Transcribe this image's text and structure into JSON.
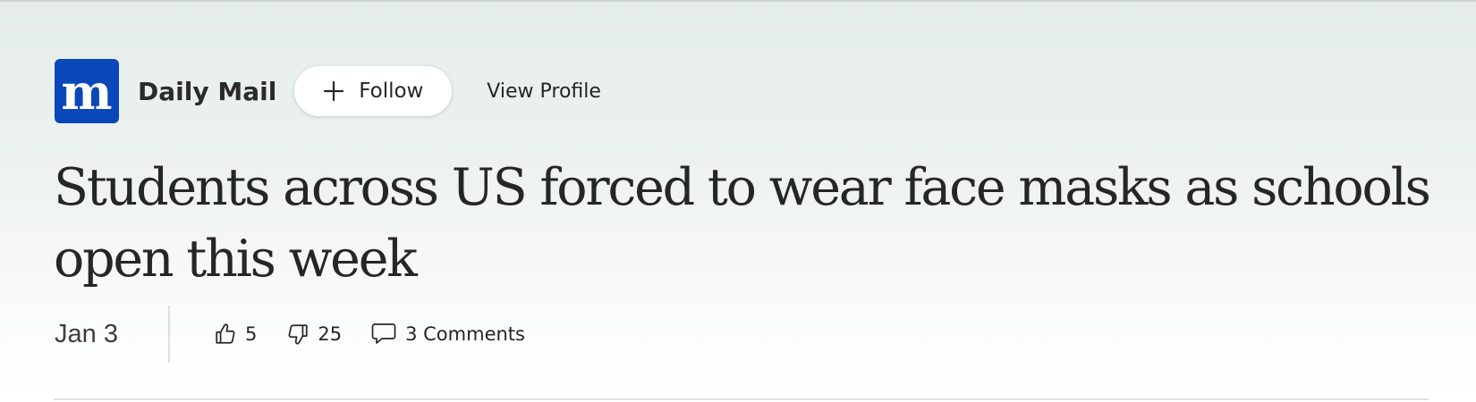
{
  "source": {
    "logo_letter": "m",
    "logo_color": "#0a47b9",
    "name": "Daily Mail",
    "follow_label": "Follow",
    "follow_icon": "plus-icon",
    "view_profile_label": "View Profile"
  },
  "article": {
    "headline": "Students across US forced to wear face masks as schools open this week"
  },
  "meta": {
    "date": "Jan 3",
    "likes": "5",
    "like_icon": "thumbs-up-icon",
    "dislikes": "25",
    "dislike_icon": "thumbs-down-icon",
    "comments_label": "3 Comments",
    "comment_icon": "comment-icon"
  }
}
